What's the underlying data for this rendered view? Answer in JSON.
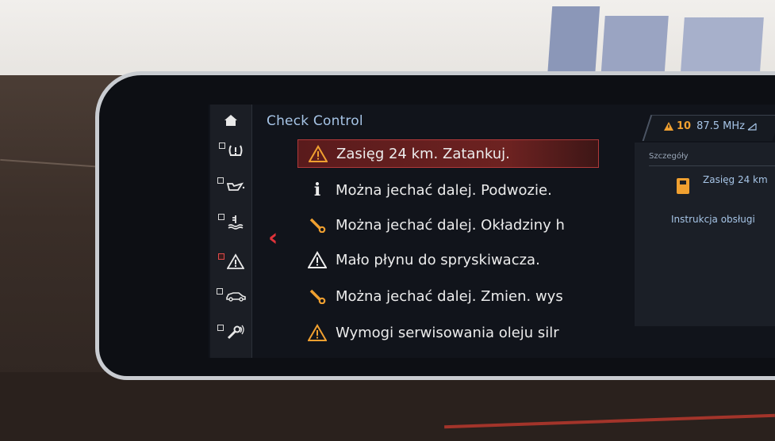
{
  "sidebar": {
    "items": [
      {
        "icon": "home-icon"
      },
      {
        "icon": "tire-pressure-icon"
      },
      {
        "icon": "oil-can-icon"
      },
      {
        "icon": "coolant-icon"
      },
      {
        "icon": "warning-icon"
      },
      {
        "icon": "car-icon"
      },
      {
        "icon": "service-wrench-icon"
      }
    ]
  },
  "main": {
    "title": "Check Control",
    "rows": [
      {
        "icon": "warning-triangle-icon",
        "text": "Zasięg 24 km. Zatankuj.",
        "selected": true
      },
      {
        "icon": "info-icon",
        "text": "Można jechać dalej. Podwozie."
      },
      {
        "icon": "wrench-icon",
        "text": "Można jechać dalej. Okładziny h"
      },
      {
        "icon": "warning-triangle-icon",
        "text": "Mało płynu do spryskiwacza."
      },
      {
        "icon": "wrench-icon",
        "text": "Można jechać dalej. Zmien. wys"
      },
      {
        "icon": "warning-triangle-icon",
        "text": "Wymogi serwisowania oleju silr"
      }
    ]
  },
  "status": {
    "warning_count": "10",
    "radio": "87.5 MHz"
  },
  "detail": {
    "heading": "Szczegóły",
    "value": "Zasięg 24 km",
    "manual": "Instrukcja obsługi"
  },
  "colors": {
    "accent_blue": "#a6c4e6",
    "warning_orange": "#f0a030",
    "selection_red": "#b0393a"
  }
}
